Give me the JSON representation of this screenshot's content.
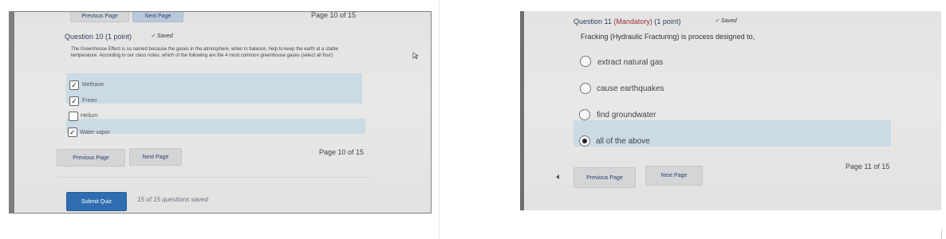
{
  "left_photo": {
    "top_nav": {
      "previous_label": "Previous Page",
      "next_label": "Next Page",
      "page_label": "Page 10 of 15"
    },
    "question": {
      "title": "Question 10 (1 point)",
      "saved_label": "Saved",
      "prompt": "The Greenhouse Effect is so named because the gases in the atmosphere, when in balance, help to keep the earth at a stable temperature. According to our class notes, which of the following are the 4 most common greenhouse gases (select all four):",
      "options": [
        {
          "label": "Methane",
          "checked": true
        },
        {
          "label": "Freon",
          "checked": true
        },
        {
          "label": "Helium",
          "checked": false
        },
        {
          "label": "Water vapor",
          "checked": true
        }
      ]
    },
    "bottom_nav": {
      "previous_label": "Previous Page",
      "next_label": "Next Page",
      "page_label": "Page 10 of 15"
    },
    "submit_label": "Submit Quiz",
    "saved_count": "15 of 15 questions saved"
  },
  "right_photo": {
    "question": {
      "title_prefix": "Question 11",
      "mandatory_label": "(Mandatory)",
      "points": "(1 point)",
      "saved_label": "Saved",
      "prompt": "Fracking (Hydraulic Fracturing) is process designed to,",
      "options": [
        {
          "label": "extract natural gas",
          "selected": false
        },
        {
          "label": "cause earthquakes",
          "selected": false
        },
        {
          "label": "find groundwater",
          "selected": false
        },
        {
          "label": "all of the above",
          "selected": true
        }
      ]
    },
    "nav": {
      "previous_label": "Previous Page",
      "next_label": "Next Page",
      "page_label": "Page 11 of 15"
    }
  },
  "colors": {
    "highlight": "#cadbe6",
    "accent_blue": "#2f6db0",
    "title_text": "#2f3f63",
    "mandatory_text": "#9b2f3c"
  }
}
